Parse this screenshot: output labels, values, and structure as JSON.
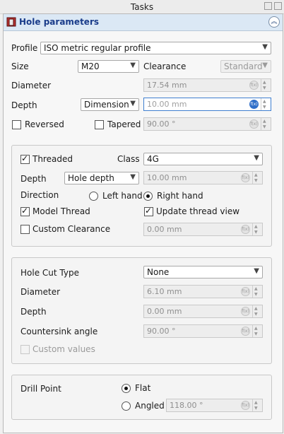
{
  "window": {
    "title": "Tasks"
  },
  "panel": {
    "title": "Hole parameters",
    "collapse_icon": "chevron-double-up-icon"
  },
  "profile": {
    "label": "Profile",
    "value": "ISO metric regular profile"
  },
  "size": {
    "label": "Size",
    "value": "M20"
  },
  "clearance": {
    "label": "Clearance",
    "value": "Standard"
  },
  "diameter": {
    "label": "Diameter",
    "value": "17.54 mm"
  },
  "depth": {
    "label": "Depth",
    "mode": "Dimension",
    "value": "10.00 mm"
  },
  "reversed": {
    "label": "Reversed",
    "checked": false
  },
  "tapered": {
    "label": "Tapered",
    "checked": false,
    "value": "90.00 °"
  },
  "thread": {
    "threaded_label": "Threaded",
    "threaded": true,
    "class_label": "Class",
    "class_value": "4G",
    "depth_label": "Depth",
    "depth_mode": "Hole depth",
    "depth_value": "10.00 mm",
    "direction_label": "Direction",
    "left_hand": "Left hand",
    "right_hand": "Right hand",
    "selected_direction": "right",
    "model_thread_label": "Model Thread",
    "model_thread": true,
    "update_view_label": "Update thread view",
    "update_view": true,
    "custom_clearance_label": "Custom Clearance",
    "custom_clearance": false,
    "custom_clearance_value": "0.00 mm"
  },
  "holecut": {
    "type_label": "Hole Cut Type",
    "type_value": "None",
    "diameter_label": "Diameter",
    "diameter_value": "6.10 mm",
    "depth_label": "Depth",
    "depth_value": "0.00 mm",
    "countersink_label": "Countersink angle",
    "countersink_value": "90.00 °",
    "custom_values_label": "Custom values",
    "custom_values": false
  },
  "drill": {
    "label": "Drill Point",
    "flat": "Flat",
    "angled": "Angled",
    "selected": "flat",
    "angled_value": "118.00 °"
  }
}
